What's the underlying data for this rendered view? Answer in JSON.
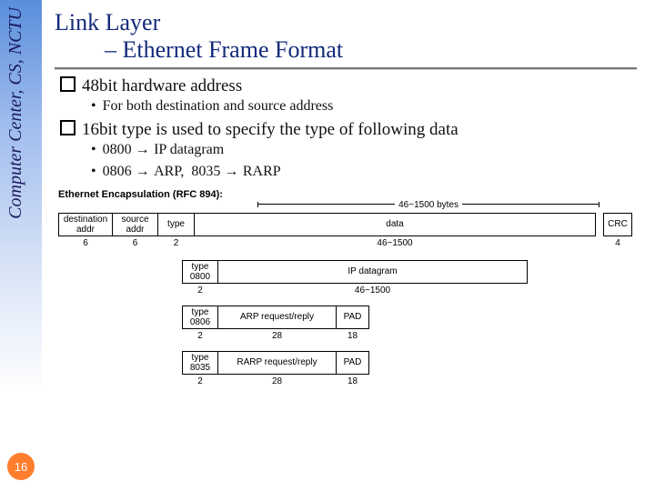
{
  "sidebar": {
    "org": "Computer Center, CS, NCTU",
    "page_number": "16"
  },
  "title": {
    "line1": "Link Layer",
    "line2": "– Ethernet Frame Format"
  },
  "bullets": {
    "b1": "48bit hardware address",
    "b1_sub": "For both destination and source address",
    "b2": "16bit type is used to specify the type of following data",
    "b2_sub1_code": "0800",
    "b2_sub1_text": "IP datagram",
    "b2_sub2a_code": "0806",
    "b2_sub2a_text": "ARP,",
    "b2_sub2b_code": "8035",
    "b2_sub2b_text": "RARP"
  },
  "diagram": {
    "enc_title": "Ethernet Encapsulation (RFC 894):",
    "range_label": "46~1500 bytes",
    "hdr": {
      "dest": {
        "label1": "destination",
        "label2": "addr",
        "size": "6"
      },
      "src": {
        "label1": "source",
        "label2": "addr",
        "size": "6"
      },
      "type": {
        "label1": "type",
        "size": "2"
      },
      "data": {
        "label1": "data",
        "size": "46~1500"
      },
      "crc": {
        "label1": "CRC",
        "size": "4"
      }
    },
    "sub1": {
      "type_label": "type",
      "type_code": "0800",
      "type_size": "2",
      "data_label": "IP datagram",
      "data_size": "46~1500"
    },
    "sub2": {
      "type_label": "type",
      "type_code": "0806",
      "type_size": "2",
      "data_label": "ARP request/reply",
      "data_size": "28",
      "pad_label": "PAD",
      "pad_size": "18"
    },
    "sub3": {
      "type_label": "type",
      "type_code": "8035",
      "type_size": "2",
      "data_label": "RARP request/reply",
      "data_size": "28",
      "pad_label": "PAD",
      "pad_size": "18"
    }
  }
}
